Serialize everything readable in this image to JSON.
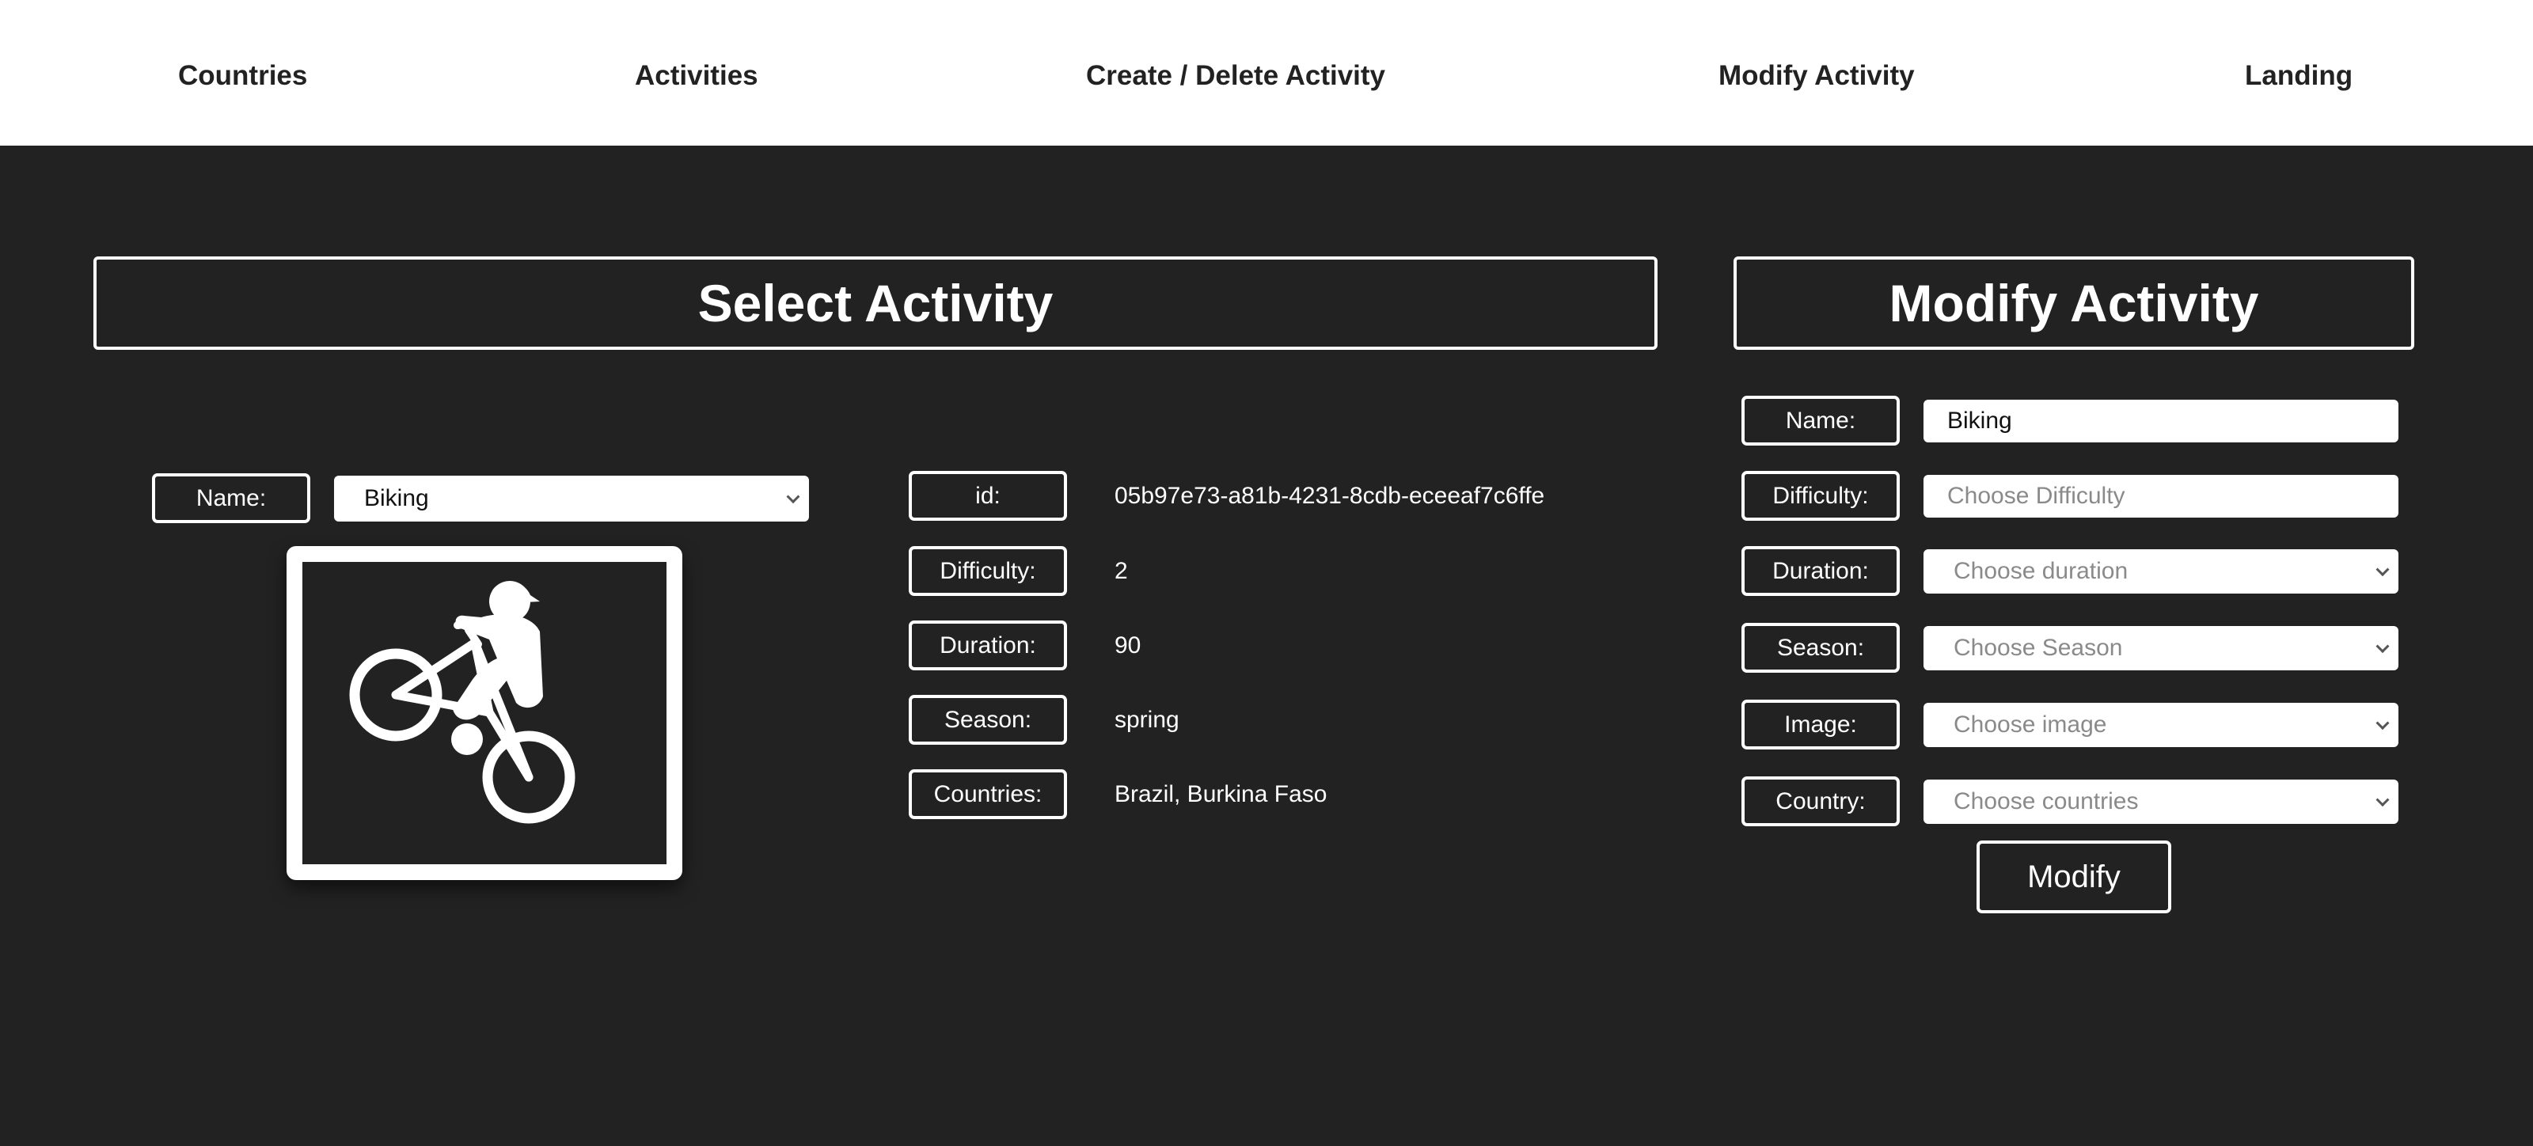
{
  "nav": {
    "countries": "Countries",
    "activities": "Activities",
    "create_delete": "Create / Delete Activity",
    "modify": "Modify Activity",
    "landing": "Landing"
  },
  "select_panel": {
    "title": "Select Activity",
    "name_label": "Name:",
    "name_value": "Biking",
    "image_icon": "biker-wheelie-icon"
  },
  "details": {
    "id_label": "id:",
    "id_value": "05b97e73-a81b-4231-8cdb-eceeaf7c6ffe",
    "difficulty_label": "Difficulty:",
    "difficulty_value": "2",
    "duration_label": "Duration:",
    "duration_value": "90",
    "season_label": "Season:",
    "season_value": "spring",
    "countries_label": "Countries:",
    "countries_value": "Brazil, Burkina Faso"
  },
  "modify_panel": {
    "title": "Modify Activity",
    "name_label": "Name:",
    "name_value": "Biking",
    "difficulty_label": "Difficulty:",
    "difficulty_placeholder": "Choose Difficulty",
    "duration_label": "Duration:",
    "duration_placeholder": "Choose duration",
    "season_label": "Season:",
    "season_placeholder": "Choose Season",
    "image_label": "Image:",
    "image_placeholder": "Choose image",
    "country_label": "Country:",
    "country_placeholder": "Choose countries",
    "submit_label": "Modify"
  },
  "colors": {
    "background": "#222222",
    "navbar": "#ffffff",
    "accent": "#ffffff"
  }
}
